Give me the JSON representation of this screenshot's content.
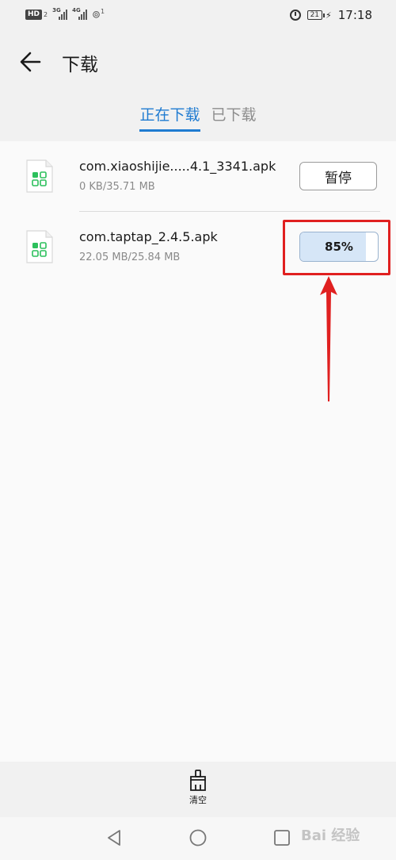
{
  "status_bar": {
    "hd_label": "HD",
    "hd_index": "2",
    "net1": "3G",
    "net2": "4G",
    "hotspot_count": "1",
    "battery": "21",
    "time": "17:18"
  },
  "header": {
    "title": "下载",
    "tabs": [
      {
        "label": "正在下载",
        "active": true
      },
      {
        "label": "已下载",
        "active": false
      }
    ]
  },
  "downloads": [
    {
      "name": "com.xiaoshijie.....4.1_3341.apk",
      "size": "0 KB/35.71 MB",
      "action_label": "暂停"
    },
    {
      "name": "com.taptap_2.4.5.apk",
      "size": "22.05 MB/25.84 MB",
      "progress_label": "85%",
      "progress": 0.85
    }
  ],
  "bottom": {
    "clear_label": "清空"
  },
  "watermark": "Bai 经验",
  "colors": {
    "accent": "#1f7bd1",
    "annotation": "#e02020",
    "progress_fill": "#d6e6f7"
  },
  "icons": [
    "back-arrow-icon",
    "apk-file-icon",
    "broom-icon",
    "nav-back-icon",
    "nav-home-icon",
    "nav-recent-icon"
  ]
}
